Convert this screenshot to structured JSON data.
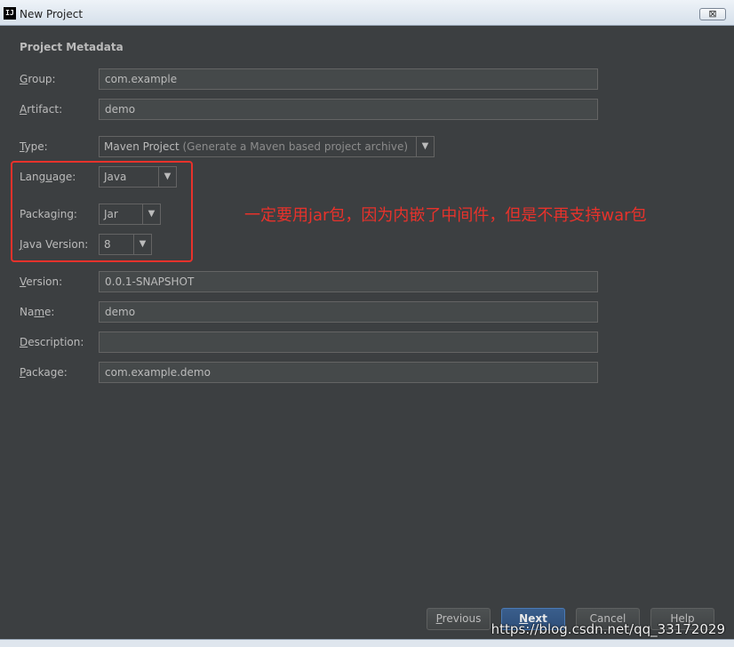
{
  "window": {
    "title": "New Project",
    "app_icon": "IJ",
    "close_symbol": "⊠"
  },
  "section_title": "Project Metadata",
  "fields": {
    "group": {
      "label_key": "G",
      "label_rest": "roup:",
      "value": "com.example"
    },
    "artifact": {
      "label_key": "A",
      "label_rest": "rtifact:",
      "value": "demo"
    },
    "type": {
      "label_key": "T",
      "label_rest": "ype:",
      "value": "Maven Project",
      "hint": "(Generate a Maven based project archive)"
    },
    "language": {
      "label_pre": "Lang",
      "label_key": "u",
      "label_rest": "age:",
      "value": "Java"
    },
    "packaging": {
      "label_pre": "Packa",
      "label_key": "g",
      "label_rest": "ing:",
      "value": "Jar"
    },
    "java_version": {
      "label_key": "J",
      "label_rest": "ava Version:",
      "value": "8"
    },
    "version": {
      "label_key": "V",
      "label_rest": "ersion:",
      "value": "0.0.1-SNAPSHOT"
    },
    "name": {
      "label_pre": "Na",
      "label_key": "m",
      "label_rest": "e:",
      "value": "demo"
    },
    "description": {
      "label_key": "D",
      "label_rest": "escription:",
      "value": ""
    },
    "package": {
      "label_key": "P",
      "label_rest": "ackage:",
      "value": "com.example.demo"
    }
  },
  "annotation": "一定要用jar包，因为内嵌了中间件，但是不再支持war包",
  "buttons": {
    "previous": {
      "key": "P",
      "rest": "revious"
    },
    "next": {
      "key": "N",
      "rest": "ext"
    },
    "cancel": "Cancel",
    "help": "Help"
  },
  "dropdown_arrow": "▼",
  "watermark": "https://blog.csdn.net/qq_33172029",
  "colors": {
    "background": "#3c3f41",
    "annotation": "#e8322b",
    "primary_button": "#2e4f7a"
  }
}
